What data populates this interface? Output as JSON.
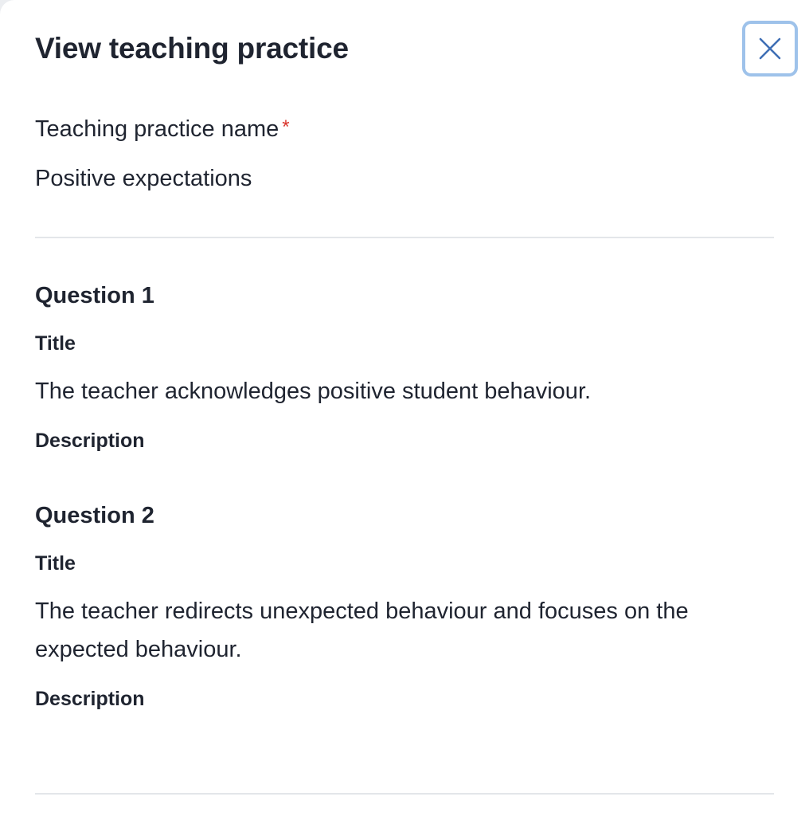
{
  "dialog": {
    "title": "View teaching practice",
    "close_icon": "close-icon"
  },
  "practice": {
    "name_label": "Teaching practice name",
    "required_marker": "*",
    "name_value": "Positive expectations"
  },
  "questions": [
    {
      "heading": "Question 1",
      "title_label": "Title",
      "title_text": "The teacher acknowledges positive student behaviour.",
      "description_label": "Description",
      "description_text": ""
    },
    {
      "heading": "Question 2",
      "title_label": "Title",
      "title_text": "The teacher redirects unexpected behaviour and focuses on the expected behaviour.",
      "description_label": "Description",
      "description_text": ""
    }
  ],
  "colors": {
    "accent_focus_ring": "#9ec2ea",
    "close_icon": "#3f6fb5",
    "required": "#d9342b",
    "divider": "#e3e6ea",
    "text": "#1f2430"
  }
}
